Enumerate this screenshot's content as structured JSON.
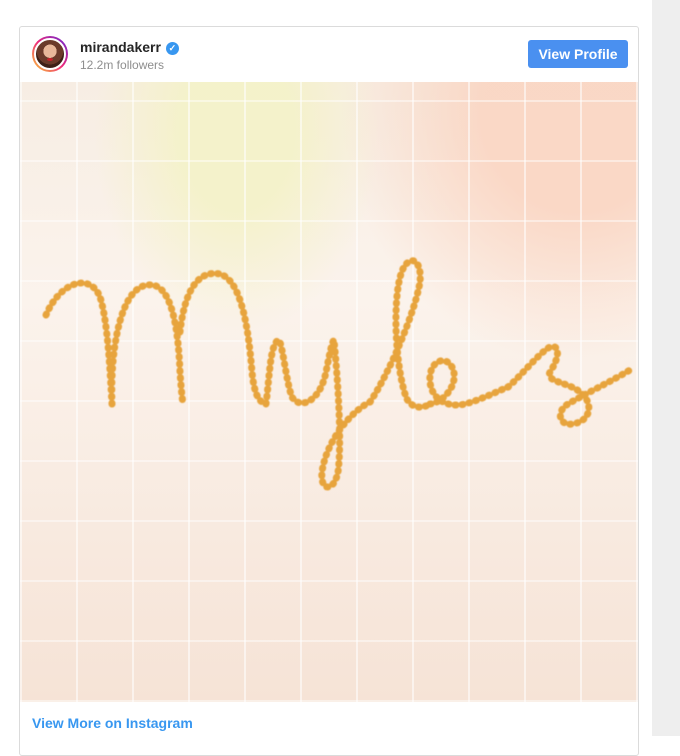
{
  "post": {
    "username": "mirandakerr",
    "followers": "12.2m followers",
    "view_profile_label": "View Profile",
    "photo_text": "Myles",
    "view_more_label": "View More on Instagram"
  },
  "icons": {
    "verified": "verified-badge-icon"
  },
  "colors": {
    "accent": "#4a90f0",
    "link": "#3897f0",
    "embroidery": "#e8a23a"
  }
}
